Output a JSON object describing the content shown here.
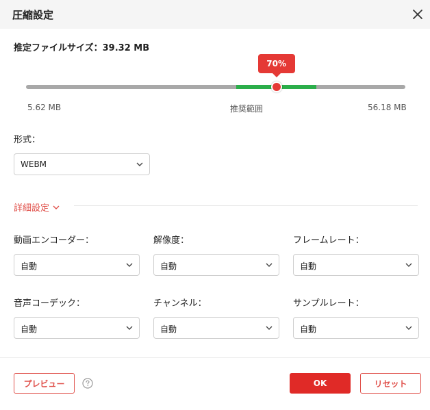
{
  "dialog": {
    "title": "圧縮設定",
    "close_icon": "close-icon"
  },
  "estimate": {
    "label": "推定ファイルサイズ：",
    "value": "39.32 MB"
  },
  "slider": {
    "percent_label": "70%",
    "fraction": 0.66,
    "recommended_start": 0.555,
    "recommended_end": 0.765,
    "min_label": "5.62 MB",
    "recommended_label": "推奨範囲",
    "max_label": "56.18 MB",
    "colors": {
      "track": "#a8a8a8",
      "recommended": "#2bae4a",
      "thumb": "#e53935"
    }
  },
  "format": {
    "label": "形式：",
    "value": "WEBM"
  },
  "advanced": {
    "label": "詳細設定",
    "video_encoder": {
      "label": "動画エンコーダー：",
      "value": "自動"
    },
    "resolution": {
      "label": "解像度：",
      "value": "自動"
    },
    "frame_rate": {
      "label": "フレームレート：",
      "value": "自動"
    },
    "audio_codec": {
      "label": "音声コーデック：",
      "value": "自動"
    },
    "channel": {
      "label": "チャンネル：",
      "value": "自動"
    },
    "sample_rate": {
      "label": "サンプルレート：",
      "value": "自動"
    }
  },
  "footer": {
    "preview_label": "プレビュー",
    "help_icon": "question-circle-icon",
    "ok_label": "OK",
    "reset_label": "リセット"
  },
  "accent_color": "#e02a27"
}
